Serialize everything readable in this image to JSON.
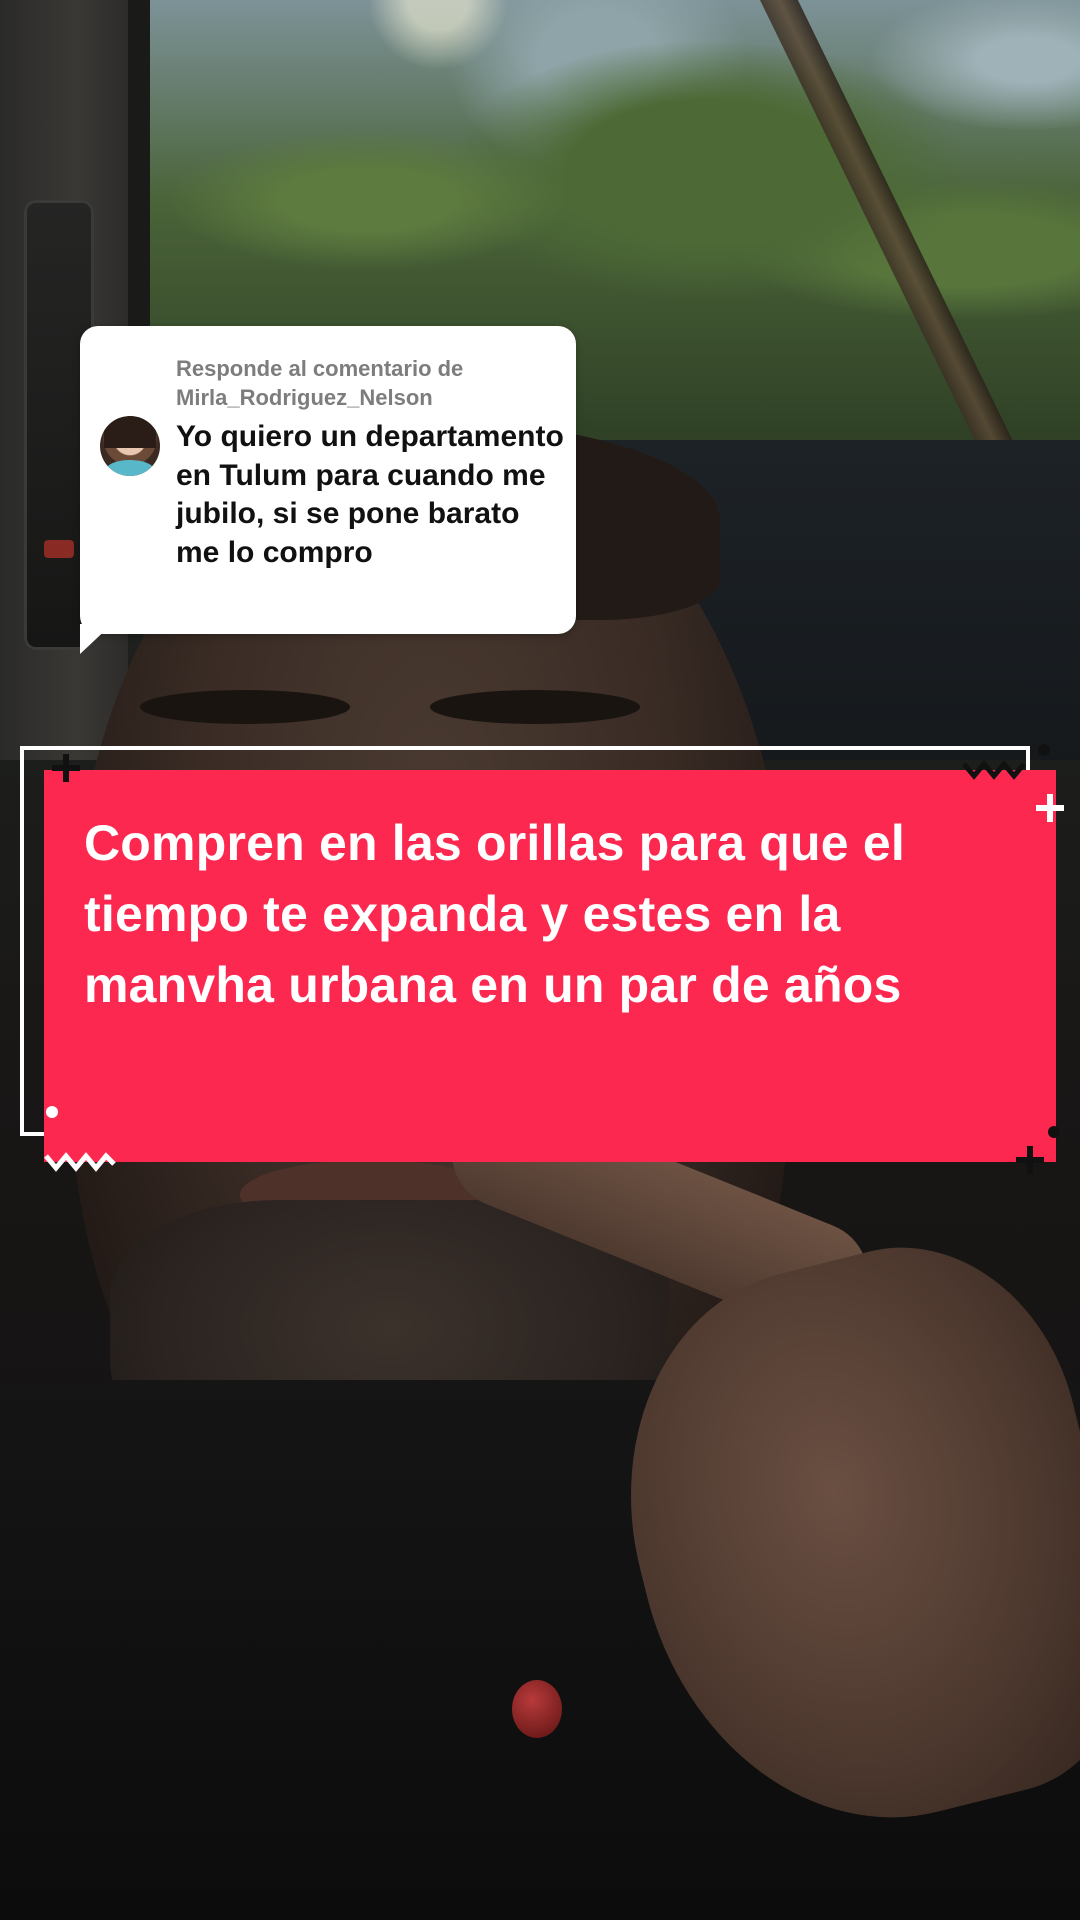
{
  "comment": {
    "reply_label": "Responde al comentario de",
    "username": "Mirla_Rodriguez_Nelson",
    "text": "Yo quiero un departamento en Tulum para cuando me jubilo, si se pone barato me lo compro"
  },
  "caption": {
    "text": "Compren en las orillas para que el tiempo te expanda y estes en la manvha urbana en un par de años"
  },
  "colors": {
    "caption_background": "#fd2850",
    "caption_text": "#ffffff",
    "comment_background": "#ffffff",
    "comment_header_text": "#7d7d7d",
    "comment_body_text": "#111111"
  },
  "icons": {
    "avatar": "commenter-avatar",
    "decorations": [
      "plus-icon",
      "zigzag-icon",
      "dot-icon"
    ]
  }
}
